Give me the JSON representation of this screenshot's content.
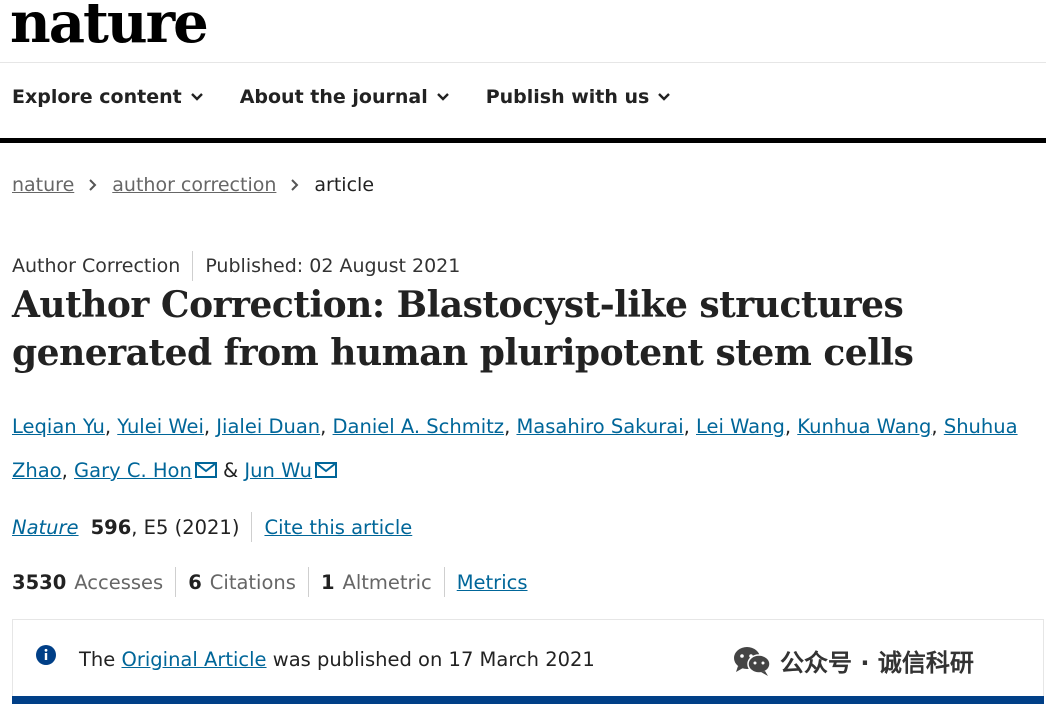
{
  "brand": {
    "logo": "nature"
  },
  "nav": {
    "items": [
      {
        "label": "Explore content"
      },
      {
        "label": "About the journal"
      },
      {
        "label": "Publish with us"
      }
    ]
  },
  "breadcrumb": {
    "items": [
      "nature",
      "author correction"
    ],
    "current": "article"
  },
  "article": {
    "type": "Author Correction",
    "published": "Published: 02 August 2021",
    "title": "Author Correction: Blastocyst-like structures generated from human pluripotent stem cells",
    "authors": [
      "Leqian Yu",
      "Yulei Wei",
      "Jialei Duan",
      "Daniel A. Schmitz",
      "Masahiro Sakurai",
      "Lei Wang",
      "Kunhua Wang",
      "Shuhua Zhao",
      "Gary C. Hon",
      "Jun Wu"
    ],
    "author_sep": ", ",
    "author_and": "&",
    "journal": "Nature",
    "volume": "596",
    "pages_year": ", E5 (2021)",
    "cite_label": "Cite this article"
  },
  "metrics": {
    "accesses_value": "3530",
    "accesses_label": "Accesses",
    "citations_value": "6",
    "citations_label": "Citations",
    "altmetric_value": "1",
    "altmetric_label": "Altmetric",
    "metrics_link": "Metrics"
  },
  "notice": {
    "prefix": "The",
    "link": "Original Article",
    "suffix": "was published on 17 March 2021"
  },
  "watermark": {
    "text": "公众号 · 诚信科研"
  },
  "colors": {
    "link": "#006699",
    "notice_bar": "#003f87",
    "info_icon": "#003f87"
  },
  "icons": [
    "chevron-down-icon",
    "chevron-right-icon",
    "mail-icon",
    "info-icon",
    "wechat-icon"
  ]
}
